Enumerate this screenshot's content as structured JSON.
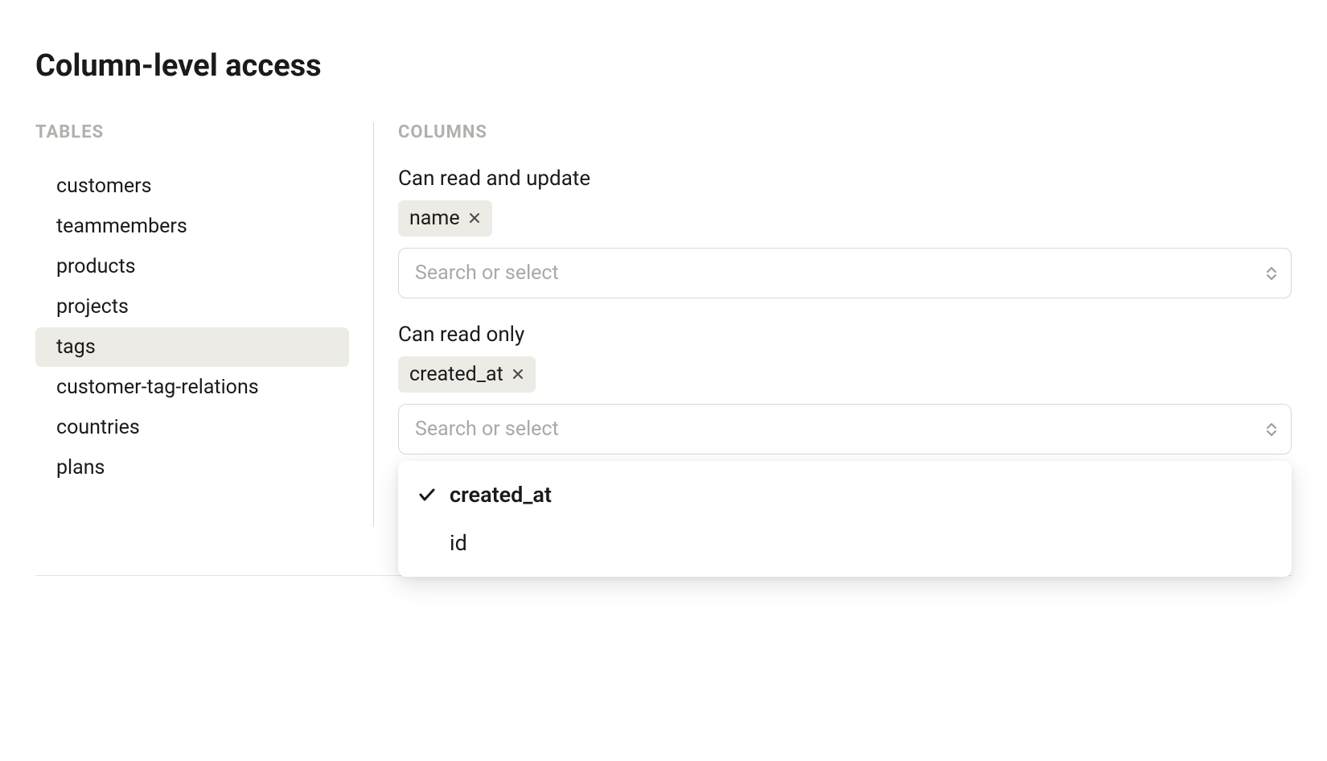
{
  "page": {
    "title": "Column-level access"
  },
  "sidebar": {
    "label": "TABLES",
    "items": [
      {
        "label": "customers",
        "selected": false
      },
      {
        "label": "teammembers",
        "selected": false
      },
      {
        "label": "products",
        "selected": false
      },
      {
        "label": "projects",
        "selected": false
      },
      {
        "label": "tags",
        "selected": true
      },
      {
        "label": "customer-tag-relations",
        "selected": false
      },
      {
        "label": "countries",
        "selected": false
      },
      {
        "label": "plans",
        "selected": false
      }
    ]
  },
  "main": {
    "label": "COLUMNS",
    "read_update": {
      "title": "Can read and update",
      "chips": [
        {
          "label": "name"
        }
      ],
      "placeholder": "Search or select"
    },
    "read_only": {
      "title": "Can read only",
      "chips": [
        {
          "label": "created_at"
        }
      ],
      "placeholder": "Search or select",
      "dropdown": {
        "options": [
          {
            "label": "created_at",
            "selected": true
          },
          {
            "label": "id",
            "selected": false
          }
        ]
      }
    }
  }
}
